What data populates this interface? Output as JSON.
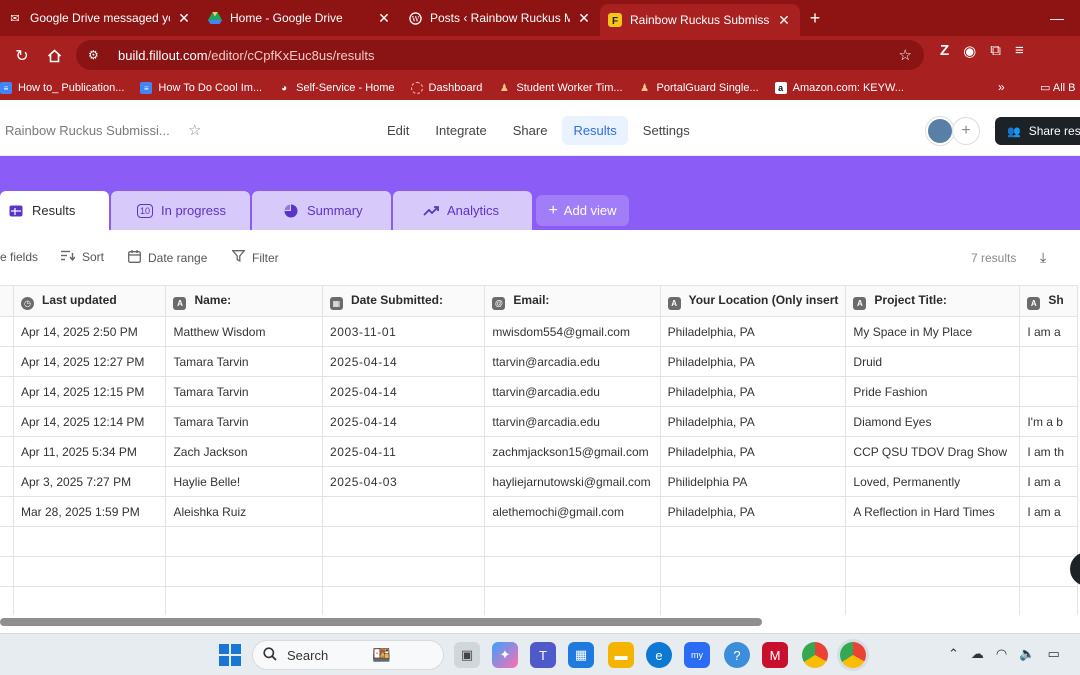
{
  "browser": {
    "tabs": [
      {
        "title": "Google Drive messaged you - C",
        "favicon": "gmail-icon",
        "active": false
      },
      {
        "title": "Home - Google Drive",
        "favicon": "drive-icon",
        "active": false
      },
      {
        "title": "Posts ‹ Rainbow Ruckus Magazi",
        "favicon": "wordpress-icon",
        "active": false
      },
      {
        "title": "Rainbow Ruckus Submission Fo",
        "favicon": "fillout-icon",
        "active": true
      }
    ],
    "new_tab_label": "+",
    "url_domain": "build.fillout.com",
    "url_path": "/editor/cCpfKxEuc8us/results",
    "bookmarks": [
      {
        "label": "How to_ Publication...",
        "icon": "docs-icon"
      },
      {
        "label": "How To Do Cool Im...",
        "icon": "docs-icon"
      },
      {
        "label": "Self-Service - Home",
        "icon": "globe-icon"
      },
      {
        "label": "Dashboard",
        "icon": "dashboard-icon"
      },
      {
        "label": "Student Worker Tim...",
        "icon": "person-icon"
      },
      {
        "label": "PortalGuard Single...",
        "icon": "person-icon"
      },
      {
        "label": "Amazon.com: KEYW...",
        "icon": "amazon-icon"
      }
    ],
    "bookmarks_more": "»",
    "all_bookmarks": "All B"
  },
  "app": {
    "form_name": "Rainbow Ruckus Submissi...",
    "nav": [
      "Edit",
      "Integrate",
      "Share",
      "Results",
      "Settings"
    ],
    "active_nav": "Results",
    "share_button": "Share res"
  },
  "views": {
    "tabs": [
      {
        "label": "Results",
        "icon": "table-icon",
        "active": true
      },
      {
        "label": "In progress",
        "icon": "progress-badge-icon",
        "badge": "10",
        "active": false
      },
      {
        "label": "Summary",
        "icon": "pie-icon",
        "active": false
      },
      {
        "label": "Analytics",
        "icon": "trend-icon",
        "active": false
      }
    ],
    "add_view": "Add view"
  },
  "toolbar": {
    "fields": "e fields",
    "sort": "Sort",
    "date_range": "Date range",
    "filter": "Filter",
    "result_count": "7 results"
  },
  "table": {
    "columns": [
      {
        "label": "Last updated",
        "icon": "clock-icon"
      },
      {
        "label": "Name:",
        "icon": "text-field-icon"
      },
      {
        "label": "Date Submitted:",
        "icon": "calendar-field-icon"
      },
      {
        "label": "Email:",
        "icon": "at-icon"
      },
      {
        "label": "Your Location (Only insert",
        "icon": "text-field-icon"
      },
      {
        "label": "Project Title:",
        "icon": "text-field-icon"
      },
      {
        "label": "Sh",
        "icon": "text-field-icon"
      }
    ],
    "rows": [
      [
        "Apr 14, 2025 2:50 PM",
        "Matthew Wisdom",
        "2003-11-01",
        "mwisdom554@gmail.com",
        "Philadelphia, PA",
        "My Space in My Place",
        "I am a"
      ],
      [
        "Apr 14, 2025 12:27 PM",
        "Tamara Tarvin",
        "2025-04-14",
        "ttarvin@arcadia.edu",
        "Philadelphia, PA",
        "Druid",
        ""
      ],
      [
        "Apr 14, 2025 12:15 PM",
        "Tamara Tarvin",
        "2025-04-14",
        "ttarvin@arcadia.edu",
        "Philadelphia, PA",
        "Pride Fashion",
        ""
      ],
      [
        "Apr 14, 2025 12:14 PM",
        "Tamara Tarvin",
        "2025-04-14",
        "ttarvin@arcadia.edu",
        "Philadelphia, PA",
        "Diamond Eyes",
        "I'm a b"
      ],
      [
        "Apr 11, 2025 5:34 PM",
        "Zach Jackson",
        "2025-04-11",
        "zachmjackson15@gmail.com",
        "Philadelphia, PA",
        "CCP QSU TDOV Drag Show",
        "I am th"
      ],
      [
        "Apr 3, 2025 7:27 PM",
        "Haylie Belle!",
        "2025-04-03",
        "hayliejarnutowski@gmail.com",
        "Philidelphia PA",
        "Loved, Permanently",
        "I am a"
      ],
      [
        "Mar 28, 2025 1:59 PM",
        "Aleishka Ruiz",
        "",
        "alethemochi@gmail.com",
        "Philadelphia, PA",
        "A Reflection in Hard Times",
        "I am a"
      ]
    ]
  },
  "taskbar": {
    "search_label": "Search"
  },
  "colors": {
    "browser_frame": "#a82020",
    "banner": "#8b5cf6",
    "active_nav": "#2f6fe4"
  }
}
